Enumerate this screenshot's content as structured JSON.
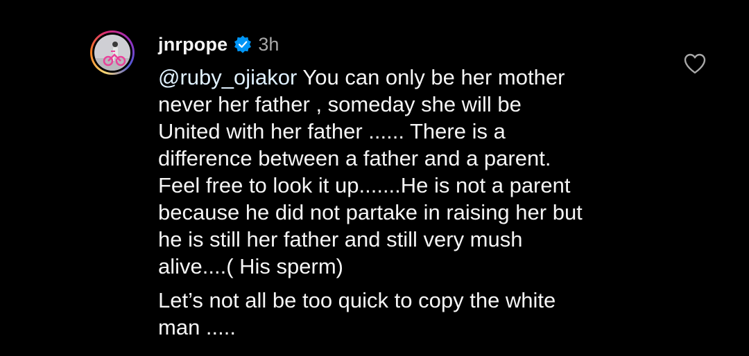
{
  "comment": {
    "username": "jnrpope",
    "time": "3h",
    "mention": "@ruby_ojiakor",
    "paragraph1_lines": [
      " You can only be her mother",
      "never her father , someday she will be",
      "United with her father ...... There is a",
      "difference between a father and a parent.",
      "Feel free to look it up.......He is not a parent",
      "because he did not partake in raising her but",
      "he is still her father and still very mush",
      "alive....( His sperm)"
    ],
    "paragraph2_lines": [
      "Let’s not all be too quick to copy the white",
      "man ....."
    ]
  },
  "icons": {
    "avatar": "profile-photo",
    "verified": "verified-badge-icon",
    "like": "heart-outline-icon"
  },
  "colors": {
    "background": "#000000",
    "text": "#f5f5f5",
    "muted": "#a8a8a8",
    "verified_blue": "#0095f6"
  }
}
